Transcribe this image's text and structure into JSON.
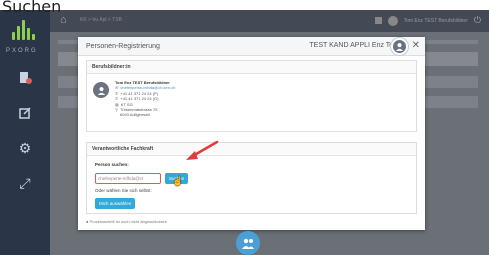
{
  "caption": "Suchen",
  "sidebar": {
    "brand": "PXORG",
    "icons": [
      "file-alert-icon",
      "edit-icon",
      "gear-icon",
      "expand-icon"
    ]
  },
  "topbar": {
    "breadcrumb": "KK > tru Apl > TSB",
    "user": "Tom Enz TEST Berufsbildner"
  },
  "modal": {
    "title": "Personen-Registrierung",
    "header_user": "TEST KAND APPLI Enz Tom",
    "section1": {
      "title": "Berufsbildner:in",
      "person": {
        "name": "Tom Enz TEST Berufsbildner",
        "email": "chefexpertw-infhda@ch.ken.ch",
        "phone1": "+41 41 371 24 24 (P)",
        "phone2": "+41 41 371 24 24 (G)",
        "company": "KT SG",
        "street": "Türkenmatstrasse 75",
        "city": "6043 Adligenswil"
      }
    },
    "section2": {
      "title": "Verantwortliche Fachkraft",
      "search_label": "Person suchen:",
      "search_value": "chefexperte-infhda@ct",
      "search_button": "Suchen",
      "or_label": "Oder wählen Sie sich selbst:",
      "self_button": "Mich auswählen"
    },
    "note": "Prozessschritt ist noch nicht abgeschlossen"
  },
  "colors": {
    "sidebar": "#2a3548",
    "accent": "#32a9d6",
    "highlight": "#e05a5a"
  }
}
